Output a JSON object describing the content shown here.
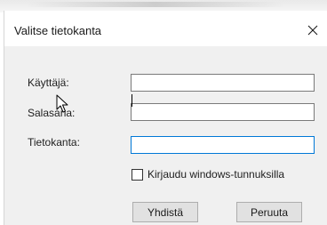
{
  "dialog": {
    "title": "Valitse tietokanta",
    "close_icon": "close-icon"
  },
  "form": {
    "username_label": "Käyttäjä:",
    "username_value": "",
    "password_label": "Salasana:",
    "password_value": "",
    "database_label": "Tietokanta:",
    "database_value": "",
    "windows_auth_label": "Kirjaudu windows-tunnuksilla",
    "windows_auth_checked": false
  },
  "buttons": {
    "connect_label": "Yhdistä",
    "cancel_label": "Peruuta"
  },
  "colors": {
    "focus_border": "#0078d7",
    "body_background": "#f0f0f0",
    "button_background": "#e1e1e1"
  },
  "icons": [
    "close-icon",
    "mouse-pointer-icon"
  ]
}
